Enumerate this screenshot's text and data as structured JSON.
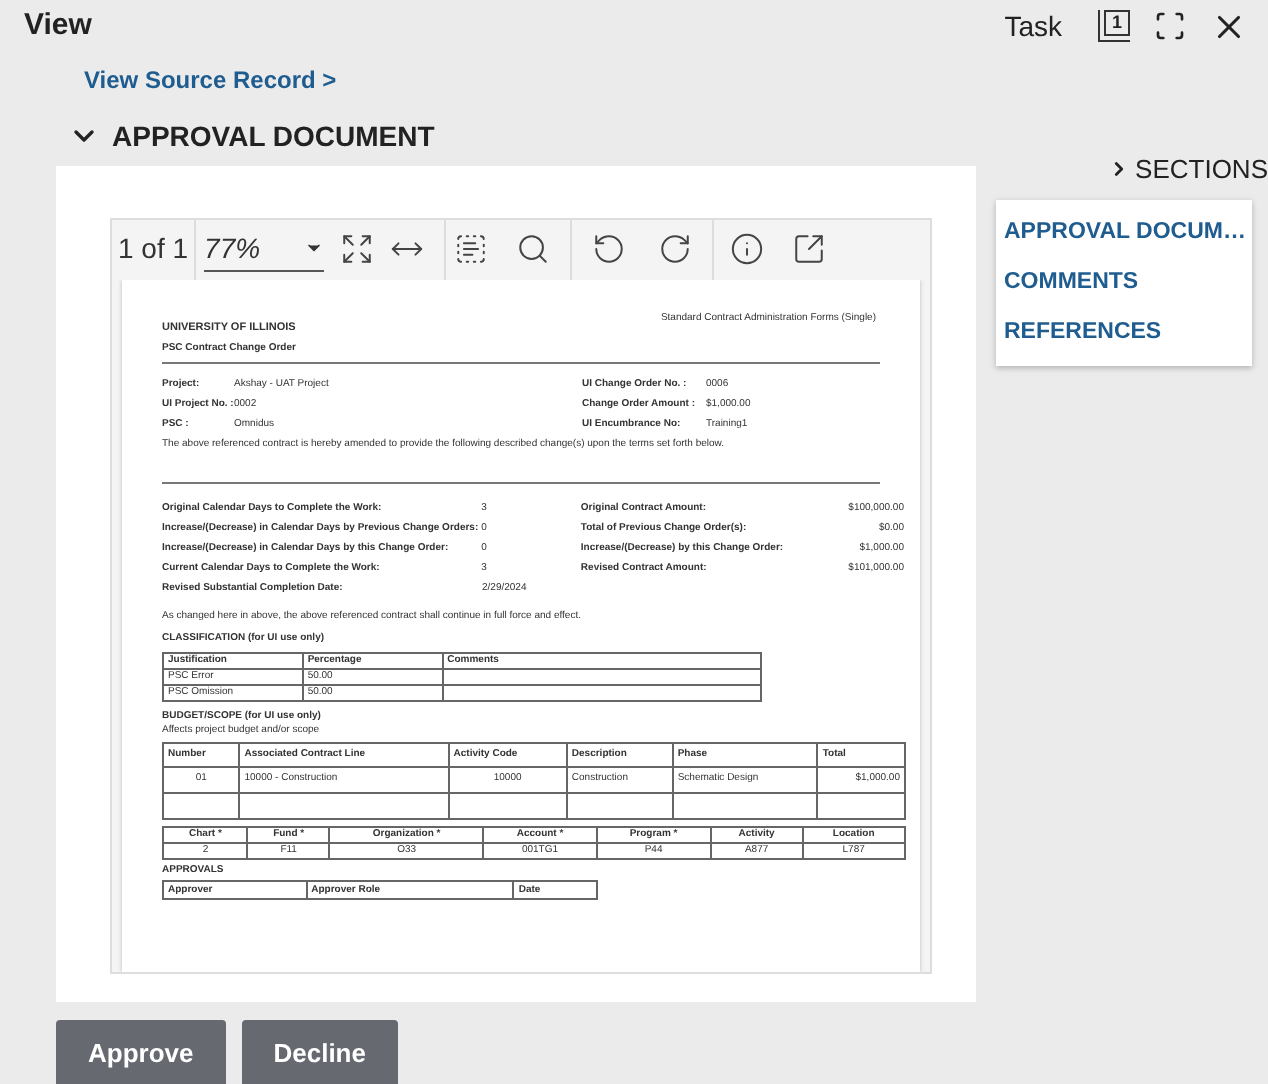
{
  "header": {
    "title": "View",
    "task": "Task",
    "pages_count": "1"
  },
  "source_link": "View Source Record >",
  "section": {
    "title": "APPROVAL DOCUMENT",
    "expanded": true
  },
  "viewer": {
    "page": "1 of 1",
    "zoom": "77%"
  },
  "document": {
    "org": "UNIVERSITY OF ILLINOIS",
    "form_name": "Standard Contract Administration Forms (Single)",
    "title": "PSC Contract Change Order",
    "project_fields": [
      {
        "label": "Project:",
        "value": "Akshay - UAT Project"
      },
      {
        "label": "UI Project No. :",
        "value": "0002"
      },
      {
        "label": "PSC :",
        "value": "Omnidus"
      }
    ],
    "order_fields": [
      {
        "label": "UI Change Order No. :",
        "value": "0006"
      },
      {
        "label": "Change Order Amount :",
        "value": "$1,000.00"
      },
      {
        "label": "UI Encumbrance No:",
        "value": "Training1"
      }
    ],
    "intro": "The above referenced contract is hereby amended to provide the following described change(s) upon the terms set forth below.",
    "days": [
      {
        "label": "Original Calendar Days to Complete the Work:",
        "value": "3"
      },
      {
        "label": "Increase/(Decrease) in Calendar Days by Previous Change Orders:",
        "value": "0"
      },
      {
        "label": "Increase/(Decrease) in Calendar Days by this Change Order:",
        "value": "0"
      },
      {
        "label": "Current Calendar Days to Complete the Work:",
        "value": "3"
      },
      {
        "label": "Revised Substantial Completion Date:",
        "value": "2/29/2024"
      }
    ],
    "amounts": [
      {
        "label": "Original Contract Amount:",
        "value": "$100,000.00"
      },
      {
        "label": "Total of Previous Change Order(s):",
        "value": "$0.00"
      },
      {
        "label": "Increase/(Decrease) by this Change Order:",
        "value": "$1,000.00"
      },
      {
        "label": "Revised Contract Amount:",
        "value": "$101,000.00"
      }
    ],
    "closing": "As changed here in above, the above referenced contract shall continue in full force and effect.",
    "classification": {
      "title": "CLASSIFICATION (for UI use only)",
      "columns": [
        "Justification",
        "Percentage",
        "Comments"
      ],
      "rows": [
        [
          "PSC Error",
          "50.00"
        ],
        [
          "PSC Omission",
          "50.00"
        ]
      ]
    },
    "budget": {
      "title": "BUDGET/SCOPE (for UI use only)",
      "note": "Affects project budget and/or scope",
      "columns": [
        "Number",
        "Associated Contract Line",
        "Activity Code",
        "Description",
        "Phase",
        "Total"
      ],
      "rows": [
        [
          "01",
          "10000 - Construction",
          "10000",
          "Construction",
          "Schematic Design",
          "$1,000.00"
        ]
      ]
    },
    "accounting": {
      "columns": [
        "Chart *",
        "Fund *",
        "Organization *",
        "Account *",
        "Program *",
        "Activity",
        "Location"
      ],
      "rows": [
        [
          "2",
          "F11",
          "O33",
          "001TG1",
          "P44",
          "A877",
          "L787"
        ]
      ]
    },
    "approvals": {
      "title": "APPROVALS",
      "columns": [
        "Approver",
        "Approver Role",
        "Date"
      ]
    }
  },
  "sections": {
    "toggle": "SECTIONS",
    "items": [
      "APPROVAL DOCUM…",
      "COMMENTS",
      "REFERENCES"
    ]
  },
  "buttons": [
    {
      "label": "Approve"
    },
    {
      "label": "Decline"
    }
  ]
}
